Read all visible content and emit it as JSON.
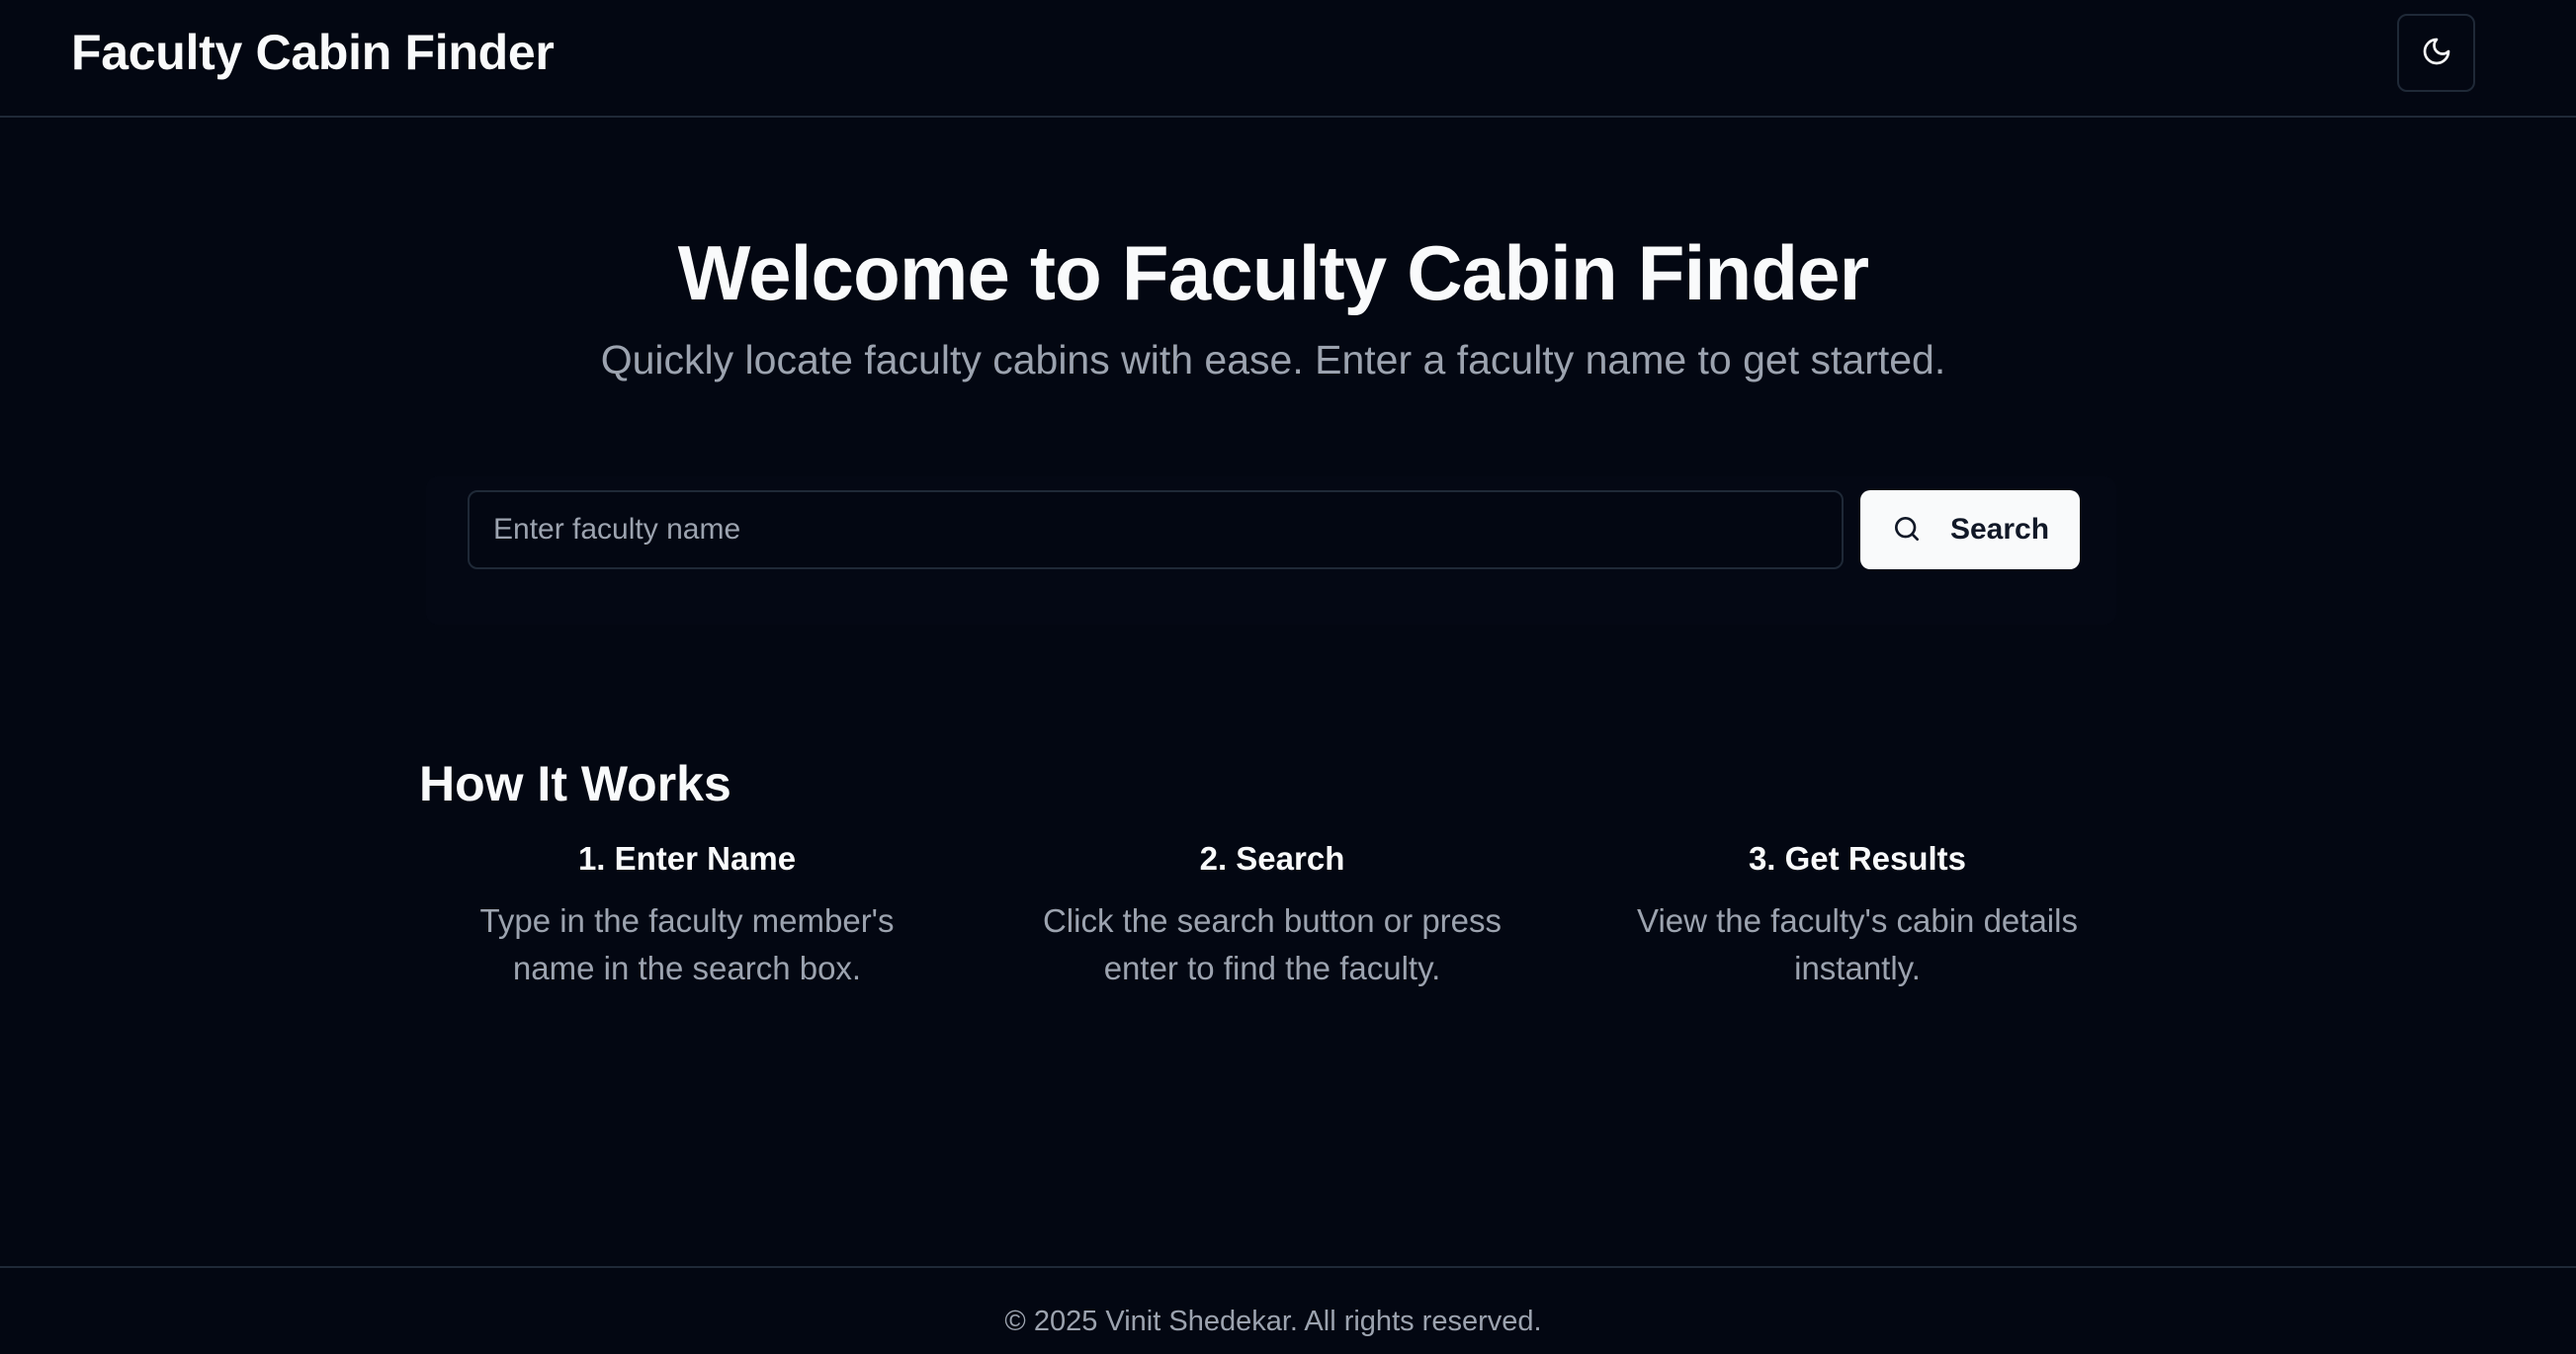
{
  "header": {
    "brand": "Faculty Cabin Finder",
    "theme_toggle_icon": "moon-icon"
  },
  "hero": {
    "title": "Welcome to Faculty Cabin Finder",
    "subtitle": "Quickly locate faculty cabins with ease. Enter a faculty name to get started."
  },
  "search": {
    "value": "",
    "placeholder": "Enter faculty name",
    "button_label": "Search",
    "button_icon": "search-icon"
  },
  "how_it_works": {
    "title": "How It Works",
    "steps": [
      {
        "title": "1. Enter Name",
        "description": "Type in the faculty member's name in the search box."
      },
      {
        "title": "2. Search",
        "description": "Click the search button or press enter to find the faculty."
      },
      {
        "title": "3. Get Results",
        "description": "View the faculty's cabin details instantly."
      }
    ]
  },
  "footer": {
    "text": "© 2025 Vinit Shedekar. All rights reserved."
  },
  "colors": {
    "background": "#030712",
    "border": "#1f2937",
    "text_primary": "#f9fafb",
    "text_muted": "#9ca3af",
    "button_bg": "#f9fafb",
    "button_text": "#111827"
  }
}
